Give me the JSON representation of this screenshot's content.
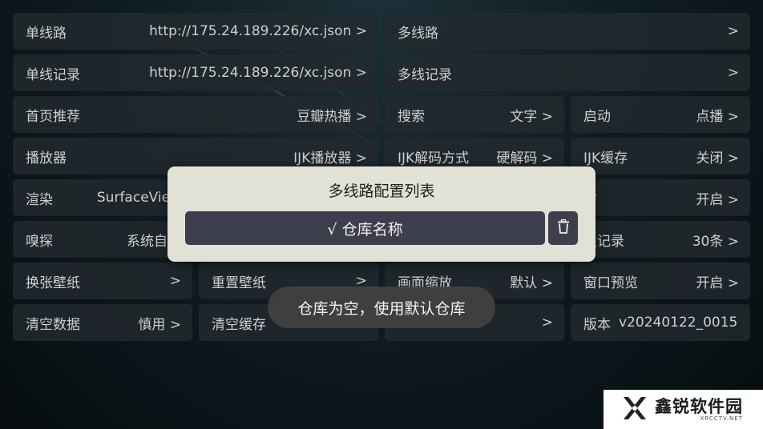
{
  "settings": {
    "rows": [
      [
        {
          "label": "单线路",
          "value": "http://175.24.189.226/xc.json >"
        },
        {
          "label": "多线路",
          "value": ">"
        }
      ],
      [
        {
          "label": "单线记录",
          "value": "http://175.24.189.226/xc.json >"
        },
        {
          "label": "多线记录",
          "value": ">"
        }
      ],
      [
        {
          "label": "首页推荐",
          "value": "豆瓣热播 >"
        },
        {
          "label": "搜索",
          "value": "文字 >"
        },
        {
          "label": "启动",
          "value": "点播 >"
        }
      ],
      [
        {
          "label": "播放器",
          "value": "IJK播放器 >"
        },
        {
          "label": "IJK解码方式",
          "value": "硬解码 >"
        },
        {
          "label": "IJK缓存",
          "value": "关闭 >"
        }
      ],
      [
        {
          "label": "渲染",
          "value": "SurfaceView"
        },
        {
          "label": "",
          "value": ""
        },
        {
          "label": "广",
          "value": "开启 >"
        }
      ],
      [
        {
          "label": "嗅探",
          "value": "系统自带"
        },
        {
          "label": "",
          "value": ""
        },
        {
          "label": "史记录",
          "value": "30条 >"
        }
      ],
      [
        {
          "label": "换张壁纸",
          "value": ">"
        },
        {
          "label": "重置壁纸",
          "value": ">"
        },
        {
          "label": "画面缩放",
          "value": "默认 >"
        },
        {
          "label": "窗口预览",
          "value": "开启 >"
        }
      ],
      [
        {
          "label": "清空数据",
          "value": "慎用 >"
        },
        {
          "label": "清空缓存",
          "value": ""
        },
        {
          "label": "",
          "value": ">"
        },
        {
          "label": "版本",
          "value": "v20240122_0015 >"
        }
      ]
    ]
  },
  "dialog": {
    "title": "多线路配置列表",
    "selected_repo": "√ 仓库名称",
    "delete_icon": "trash-icon"
  },
  "toast": {
    "message": "仓库为空，使用默认仓库"
  },
  "watermark": {
    "brand": "鑫锐软件园",
    "sub": "XRCCTV.NET"
  },
  "colors": {
    "dialog_bg": "#e2e1d5",
    "item_bg": "#3e3f4c",
    "cell_bg": "#232a2e"
  }
}
